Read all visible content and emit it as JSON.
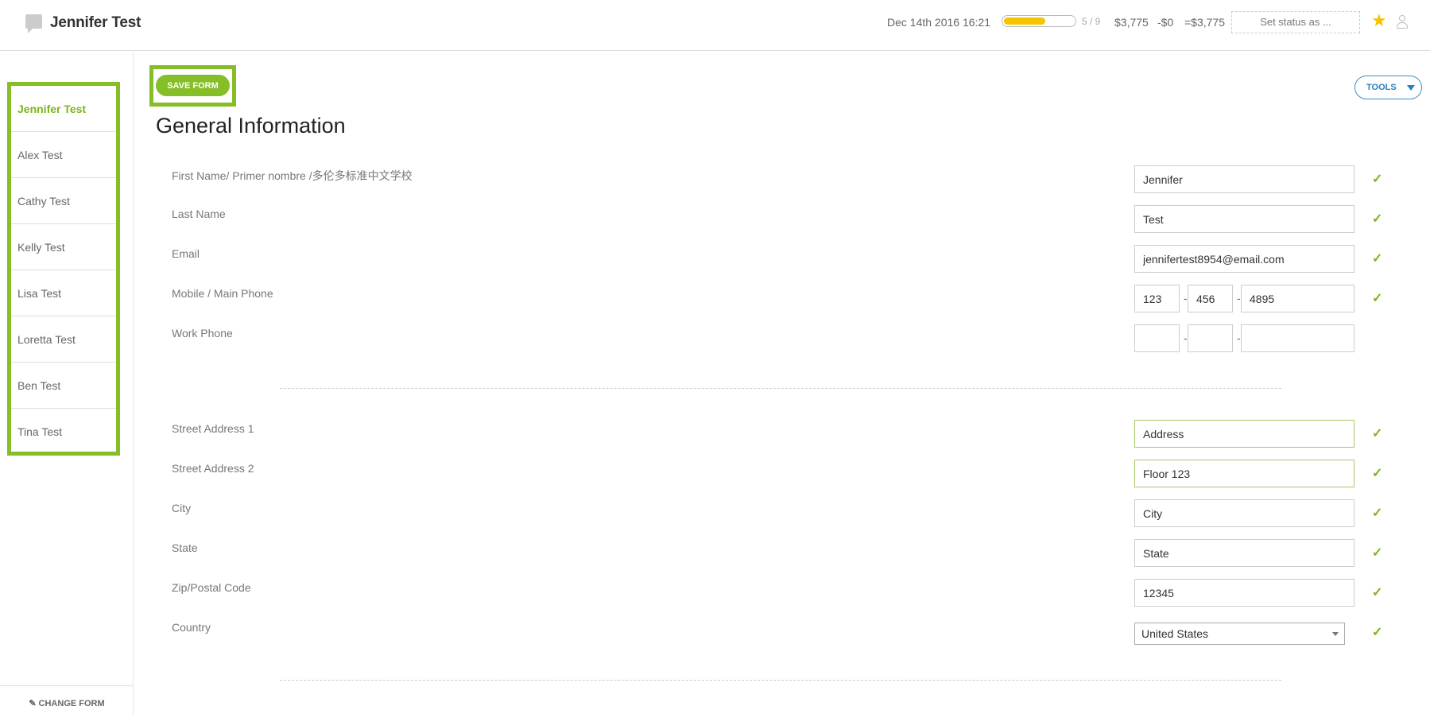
{
  "header": {
    "title": "Jennifer Test",
    "datetime": "Dec 14th 2016 16:21",
    "progress": {
      "fraction": 0.56,
      "text": "5 / 9"
    },
    "amount_total": "$3,775",
    "amount_minus": "-$0",
    "amount_result": "=$3,775",
    "status_placeholder": "Set status as ...",
    "icons": [
      "chat-icon",
      "star-icon",
      "user-icon"
    ],
    "star_color": "#f5c400"
  },
  "sidebar": {
    "people": [
      {
        "name": "Jennifer Test",
        "active": true
      },
      {
        "name": "Alex Test"
      },
      {
        "name": "Cathy Test"
      },
      {
        "name": "Kelly Test"
      },
      {
        "name": "Lisa Test"
      },
      {
        "name": "Loretta Test"
      },
      {
        "name": "Ben Test"
      },
      {
        "name": "Tina Test"
      }
    ],
    "change_form_label": "CHANGE FORM"
  },
  "toolbar": {
    "save_label": "SAVE FORM",
    "tools_label": "TOOLS"
  },
  "form": {
    "section_title": "General Information",
    "fields": {
      "first_name": {
        "label": "First Name/ Primer nombre /多伦多标准中文学校",
        "value": "Jennifer"
      },
      "last_name": {
        "label": "Last Name",
        "value": "Test"
      },
      "email": {
        "label": "Email",
        "value": "jennifertest8954@email.com"
      },
      "mobile_phone": {
        "label": "Mobile / Main Phone",
        "part1": "123",
        "part2": "456",
        "part3": "4895"
      },
      "work_phone": {
        "label": "Work Phone",
        "part1": "",
        "part2": "",
        "part3": ""
      },
      "street1": {
        "label": "Street Address 1",
        "value": "Address"
      },
      "street2": {
        "label": "Street Address 2",
        "value": "Floor 123"
      },
      "city": {
        "label": "City",
        "value": "City"
      },
      "state": {
        "label": "State",
        "value": "State"
      },
      "zip": {
        "label": "Zip/Postal Code",
        "value": "12345"
      },
      "country": {
        "label": "Country",
        "value": "United States"
      }
    },
    "phone_separator": "-",
    "check_glyph": "✓"
  },
  "colors": {
    "accent_green": "#86be27",
    "link_blue": "#2a7fbf"
  }
}
